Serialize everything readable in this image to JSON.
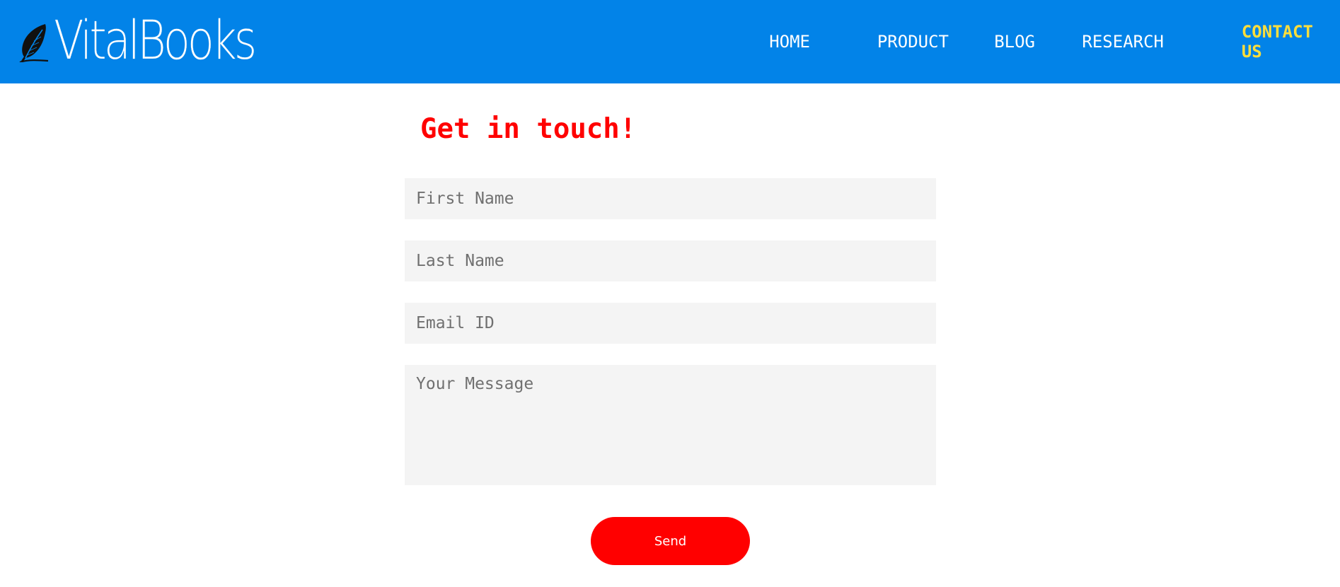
{
  "brand": {
    "name": "VitalBooks",
    "logo_icon": "feather-quill-icon"
  },
  "nav": {
    "items": [
      {
        "label": "HOME",
        "active": false
      },
      {
        "label": "PRODUCT",
        "active": false
      },
      {
        "label": "BLOG",
        "active": false
      },
      {
        "label": "RESEARCH",
        "active": false
      },
      {
        "label": "CONTACT US",
        "active": true
      }
    ]
  },
  "contact": {
    "title": "Get in touch!",
    "first_name_placeholder": "First Name",
    "last_name_placeholder": "Last Name",
    "email_placeholder": "Email ID",
    "message_placeholder": "Your Message",
    "send_label": "Send"
  },
  "colors": {
    "header_bg": "#0283e8",
    "nav_active": "#ffde3b",
    "accent_red": "#ff0000",
    "field_bg": "#f4f4f4"
  }
}
